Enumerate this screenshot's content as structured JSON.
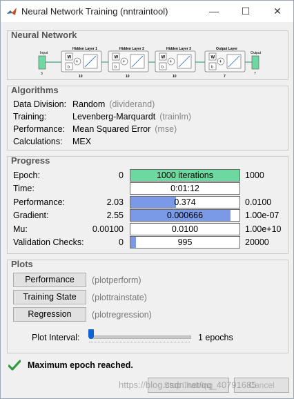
{
  "window": {
    "title": "Neural Network Training (nntraintool)",
    "minimize_glyph": "—",
    "maximize_glyph": "☐",
    "close_glyph": "✕"
  },
  "network": {
    "panel_title": "Neural Network",
    "input_label": "Input",
    "input_size": "3",
    "layers": [
      {
        "title": "Hidden Layer 1",
        "size": "10"
      },
      {
        "title": "Hidden Layer 2",
        "size": "10"
      },
      {
        "title": "Hidden Layer 3",
        "size": "10"
      },
      {
        "title": "Output Layer",
        "size": "7"
      }
    ],
    "output_label": "Output",
    "output_size": "7",
    "weight_symbol": "W",
    "bias_symbol": "b",
    "sum_symbol": "+"
  },
  "algorithms": {
    "panel_title": "Algorithms",
    "rows": [
      {
        "label": "Data Division:",
        "value": "Random",
        "code": "(dividerand)"
      },
      {
        "label": "Training:",
        "value": "Levenberg-Marquardt",
        "code": "(trainlm)"
      },
      {
        "label": "Performance:",
        "value": "Mean Squared Error",
        "code": "(mse)"
      },
      {
        "label": "Calculations:",
        "value": "MEX",
        "code": ""
      }
    ]
  },
  "progress": {
    "panel_title": "Progress",
    "rows": [
      {
        "label": "Epoch:",
        "start": "0",
        "bar_text": "1000 iterations",
        "end": "1000",
        "fill": 1.0,
        "fill_color": "#6dd9a0"
      },
      {
        "label": "Time:",
        "start": "",
        "bar_text": "0:01:12",
        "end": "",
        "fill": 0,
        "fill_color": "#ffffff"
      },
      {
        "label": "Performance:",
        "start": "2.03",
        "bar_text": "0.374",
        "end": "0.0100",
        "fill": 0.42,
        "fill_color": "#7a9ae8"
      },
      {
        "label": "Gradient:",
        "start": "2.55",
        "bar_text": "0.000666",
        "end": "1.00e-07",
        "fill": 0.92,
        "fill_color": "#7a9ae8"
      },
      {
        "label": "Mu:",
        "start": "0.00100",
        "bar_text": "0.0100",
        "end": "1.00e+10",
        "fill": 0.0,
        "fill_color": "#7a9ae8"
      },
      {
        "label": "Validation Checks:",
        "start": "0",
        "bar_text": "995",
        "end": "20000",
        "fill": 0.05,
        "fill_color": "#7a9ae8"
      }
    ]
  },
  "plots": {
    "panel_title": "Plots",
    "buttons": [
      {
        "label": "Performance",
        "code": "(plotperform)"
      },
      {
        "label": "Training State",
        "code": "(plottrainstate)"
      },
      {
        "label": "Regression",
        "code": "(plotregression)"
      }
    ],
    "interval_label": "Plot Interval:",
    "interval_value": "1 epochs",
    "interval_level": 0.0
  },
  "status": {
    "text": "Maximum epoch reached."
  },
  "footer": {
    "stop_label": "Stop Training",
    "cancel_label": "Cancel",
    "watermark": "https://blog.csdn.net/qq_40791685"
  },
  "colors": {
    "status_check": "#2e9b3a",
    "layer_link": "#3aa088",
    "input_box": "#6dd9a0"
  }
}
